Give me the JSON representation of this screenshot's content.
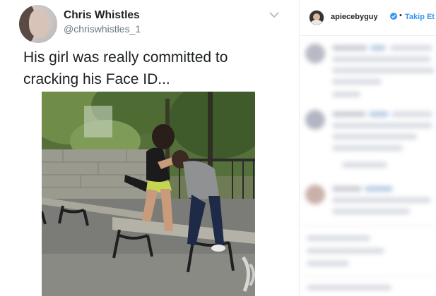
{
  "tweet": {
    "name": "Chris Whistles",
    "handle": "@chriswhistles_1",
    "text": "His girl was really committed to cracking his Face ID...",
    "menu_icon": "chevron-down-icon",
    "media_alt_icon": "video-still"
  },
  "instagram": {
    "username": "apiecebyguy",
    "verified_icon": "verified-badge-icon",
    "separator": "•",
    "follow_label": "Takip Et"
  },
  "colors": {
    "tweet_text": "#1c2022",
    "handle": "#697882",
    "follow_blue": "#3897f0",
    "verified_blue": "#3897f0"
  }
}
